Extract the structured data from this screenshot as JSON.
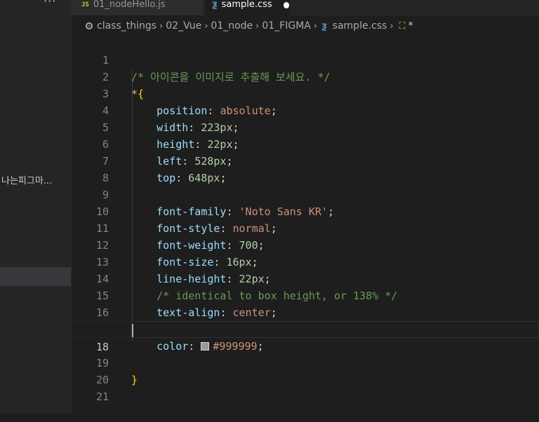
{
  "sidebar": {
    "more_label": "···",
    "item_label": "나는피그마..."
  },
  "tabs": [
    {
      "icon": "JS",
      "label": "01_nodeHello.js"
    },
    {
      "icon": "ƺ",
      "label": "sample.css"
    }
  ],
  "breadcrumb": [
    "class_things",
    "02_Vue",
    "01_node",
    "01_FIGMA",
    "sample.css",
    "*"
  ],
  "editor": {
    "lines": [
      {
        "n": "1"
      },
      {
        "n": "2"
      },
      {
        "n": "3"
      },
      {
        "n": "4"
      },
      {
        "n": "5"
      },
      {
        "n": "6"
      },
      {
        "n": "7"
      },
      {
        "n": "8"
      },
      {
        "n": "9"
      },
      {
        "n": "10"
      },
      {
        "n": "11"
      },
      {
        "n": "12"
      },
      {
        "n": "13"
      },
      {
        "n": "14"
      },
      {
        "n": "15"
      },
      {
        "n": "16"
      },
      {
        "n": "17"
      },
      {
        "n": "18"
      },
      {
        "n": "19"
      },
      {
        "n": "20"
      },
      {
        "n": "21"
      }
    ],
    "code": {
      "l1": "/* 아이콘을 이미지로 추출해 보세요. */",
      "l2_sel": "*",
      "l2_brace": "{",
      "l3_prop": "position",
      "l3_val": "absolute",
      "l4_prop": "width",
      "l4_val": "223px",
      "l5_prop": "height",
      "l5_val": "22px",
      "l6_prop": "left",
      "l6_val": "528px",
      "l7_prop": "top",
      "l7_val": "648px",
      "l9_prop": "font-family",
      "l9_val": "'Noto Sans KR'",
      "l10_prop": "font-style",
      "l10_val": "normal",
      "l11_prop": "font-weight",
      "l11_val": "700",
      "l12_prop": "font-size",
      "l12_val": "16px",
      "l13_prop": "line-height",
      "l13_val": "22px",
      "l14": "/* identical to box height, or 138% */",
      "l15_prop": "text-align",
      "l15_val": "center",
      "l17_prop": "color",
      "l17_val": "#999999",
      "l19_brace": "}"
    },
    "active_line": "18",
    "swatch_color": "#999999"
  }
}
